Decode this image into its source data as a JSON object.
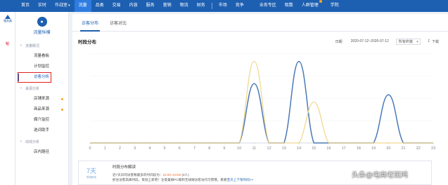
{
  "topnav": {
    "items": [
      {
        "label": "首页",
        "active": false,
        "caret": false
      },
      {
        "label": "实时",
        "active": false,
        "caret": false
      },
      {
        "label": "作战室",
        "active": false,
        "caret": true
      },
      {
        "label": "流量",
        "active": true,
        "caret": false
      },
      {
        "label": "品类",
        "active": false,
        "caret": false
      },
      {
        "label": "交易",
        "active": false,
        "caret": false
      },
      {
        "label": "内容",
        "active": false,
        "caret": false
      },
      {
        "label": "服务",
        "active": false,
        "caret": false
      },
      {
        "label": "营销",
        "active": false,
        "caret": false
      },
      {
        "label": "物流",
        "active": false,
        "caret": false
      },
      {
        "label": "财务",
        "active": false,
        "caret": false
      }
    ],
    "right_items": [
      {
        "label": "市场",
        "dot": false
      },
      {
        "label": "竞争",
        "dot": false
      },
      {
        "label": "业务专区",
        "dot": false
      },
      {
        "label": "取数",
        "dot": false
      },
      {
        "label": "人群管理",
        "dot": true
      },
      {
        "label": "学院",
        "dot": false
      }
    ]
  },
  "rail": {
    "logo_text": "服务器",
    "mini_text": "稻"
  },
  "sidebar": {
    "title": "流量纵横",
    "groups": [
      {
        "label": "流量概况",
        "items": [
          {
            "label": "流量看板",
            "active": false,
            "dot": false
          },
          {
            "label": "计划监控",
            "active": false,
            "dot": false
          },
          {
            "label": "访客分析",
            "active": true,
            "dot": false
          }
        ]
      },
      {
        "label": "来源分析",
        "items": [
          {
            "label": "店铺来源",
            "active": false,
            "dot": true
          },
          {
            "label": "商品来源",
            "active": false,
            "dot": true
          },
          {
            "label": "媒介监控",
            "active": false,
            "dot": false
          },
          {
            "label": "选词助手",
            "active": false,
            "dot": false
          }
        ]
      },
      {
        "label": "动线分析",
        "items": [
          {
            "label": "店内路径",
            "active": false,
            "dot": false
          }
        ]
      }
    ]
  },
  "tabs": [
    {
      "label": "访客分布",
      "active": true
    },
    {
      "label": "访客对比",
      "active": false
    }
  ],
  "panel": {
    "title": "时段分布",
    "date_label": "日期",
    "date_range": "2020-07-12~2020-07-12",
    "device_select": "所有终端",
    "download_label": "下载"
  },
  "chart_data": {
    "type": "line",
    "x": [
      "0",
      "1",
      "2",
      "3",
      "4",
      "5",
      "6",
      "7",
      "8",
      "9",
      "10",
      "11",
      "12",
      "13",
      "14",
      "15",
      "16",
      "17",
      "18",
      "19",
      "20",
      "21",
      "22",
      "23"
    ],
    "series": [
      {
        "color": "#4a7ab8",
        "values": [
          0,
          0,
          0,
          0,
          0,
          0,
          0,
          0,
          0,
          0,
          0,
          1.6,
          0,
          0,
          2.2,
          0,
          0,
          0,
          0,
          0,
          1.3,
          0,
          0,
          0
        ]
      },
      {
        "color": "#f0d68a",
        "values": [
          0,
          0,
          0,
          0,
          0,
          0,
          0,
          0,
          0,
          0,
          0,
          2.2,
          0,
          0,
          0,
          1.1,
          0,
          0,
          0,
          0,
          0,
          0,
          0,
          0
        ]
      }
    ],
    "ylim": [
      0,
      2.4
    ],
    "grid": true,
    "legend": "none"
  },
  "note": {
    "big_number": "7天",
    "big_sub": "数据解读",
    "title": "时段分布解读",
    "line1_prefix": "近7天日均访客数最多的时间段为：",
    "line1_highlight": "22:00~23:59",
    "line1_suffix": "(2人)",
    "line2_text": "抓住访客高峰时段，策划上新吧！注意兼顾PC端和无线端访客访问习惯哦，看看",
    "line2_link": "宝贝上下架时间>>"
  },
  "watermark": "头条@电商老斑鸠"
}
